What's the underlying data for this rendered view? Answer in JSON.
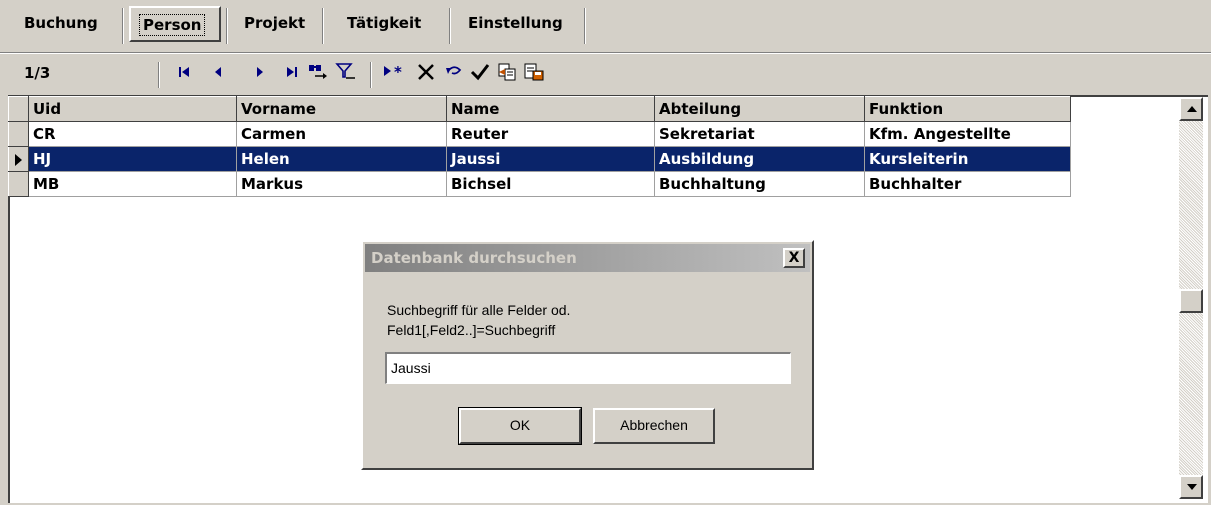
{
  "tabs": [
    "Buchung",
    "Person",
    "Projekt",
    "Tätigkeit",
    "Einstellung"
  ],
  "selected_tab": "Person",
  "toolbar": {
    "record_position": "1/3",
    "icons": [
      "first-record-icon",
      "prev-record-icon",
      "next-record-icon",
      "last-record-icon",
      "search-icon",
      "filter-icon",
      "new-record-icon",
      "delete-icon",
      "undo-icon",
      "save-checkmark-icon",
      "copy-icon",
      "export-icon"
    ]
  },
  "grid": {
    "columns": [
      "Uid",
      "Vorname",
      "Name",
      "Abteilung",
      "Funktion"
    ],
    "rows": [
      [
        "CR",
        "Carmen",
        "Reuter",
        "Sekretariat",
        "Kfm. Angestellte"
      ],
      [
        "HJ",
        "Helen",
        "Jaussi",
        "Ausbildung",
        "Kursleiterin"
      ],
      [
        "MB",
        "Markus",
        "Bichsel",
        "Buchhaltung",
        "Buchhalter"
      ]
    ],
    "selected_row": 1
  },
  "dialog": {
    "title": "Datenbank durchsuchen",
    "close_glyph": "X",
    "label_line1": "Suchbegriff für alle Felder od.",
    "label_line2": "Feld1[,Feld2..]=Suchbegriff",
    "input_value": "Jaussi",
    "ok_label": "OK",
    "cancel_label": "Abbrechen"
  },
  "colors": {
    "selection": "#0a246a",
    "window_bg": "#d4d0c8",
    "icon_blue": "#000080"
  }
}
